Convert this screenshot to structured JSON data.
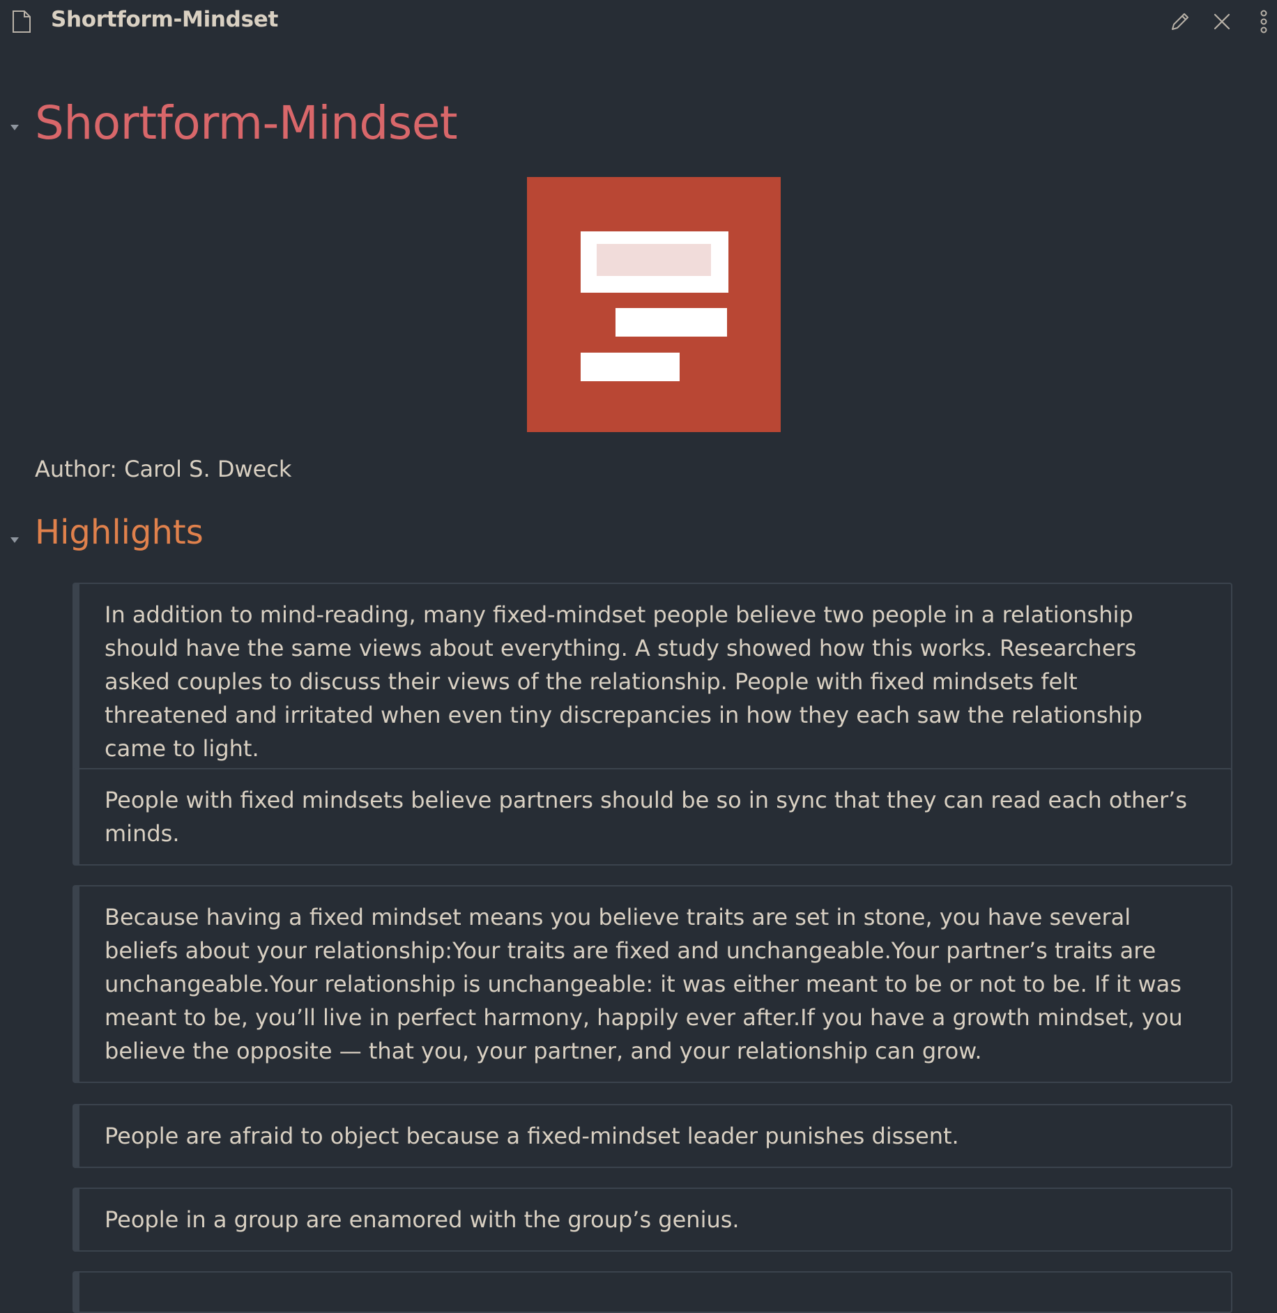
{
  "window": {
    "title": "Shortform-Mindset",
    "icons": {
      "file": "file-icon",
      "edit": "pencil-icon",
      "close": "close-icon",
      "more": "more-vertical-icon"
    }
  },
  "note": {
    "title": "Shortform-Mindset",
    "cover_alt": "Shortform logo",
    "cover_colors": {
      "background": "#b94734",
      "bars": "#ffffff",
      "inner": "#f1dcda"
    },
    "author": "Author: Carol S. Dweck",
    "highlights_heading": "Highlights",
    "highlights": [
      "In addition to mind-reading, many fixed-mindset people believe two people in a relationship should have the same views about everything. A study showed how this works. Researchers asked couples to discuss their views of the relationship. People with fixed mindsets felt threatened and irritated when even tiny discrepancies in how they each saw the relationship came to light.",
      "People with fixed mindsets believe partners should be so in sync that they can read each other’s minds.",
      "Because having a fixed mindset means you believe traits are set in stone, you have several beliefs about your relationship:Your traits are fixed and unchangeable.Your partner’s traits are unchangeable.Your relationship is unchangeable: it was either meant to be or not to be. If it was meant to be, you’ll live in perfect harmony, happily ever after.If you have a growth mindset, you believe the opposite — that you, your partner, and your relationship can grow.",
      "People are afraid to object because a fixed-mindset leader punishes dissent.",
      "People in a group are enamored with the group’s genius."
    ]
  },
  "colors": {
    "background": "#272d35",
    "title": "#d9676a",
    "heading": "#e0814c",
    "text": "#d9d0c2",
    "quote_border": "#3b434d"
  }
}
